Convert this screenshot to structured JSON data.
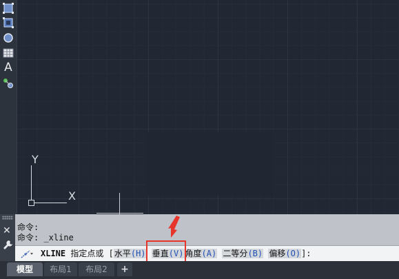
{
  "ucs": {
    "y_label": "Y",
    "x_label": "X"
  },
  "toolbar": {
    "tools": [
      {
        "name": "select-window-icon"
      },
      {
        "name": "crossing-window-icon"
      },
      {
        "name": "polygon-select-icon"
      },
      {
        "name": "table-icon"
      },
      {
        "name": "text-icon",
        "glyph": "A"
      },
      {
        "name": "point-style-icon"
      }
    ]
  },
  "command": {
    "history": [
      "命令:",
      "命令: _xline"
    ],
    "prompt_name": "XLINE",
    "prompt_text": "指定点或",
    "bracket_open": "[",
    "bracket_close": "]:",
    "options": [
      {
        "label": "水平",
        "key": "(H)"
      },
      {
        "label": "垂直",
        "key": "(V)"
      },
      {
        "label": "角度",
        "key": "(A)"
      },
      {
        "label": "二等分",
        "key": "(B)"
      },
      {
        "label": "偏移",
        "key": "(O)"
      }
    ],
    "close_glyph": "✕",
    "wrench_glyph": "🔧"
  },
  "tabs": {
    "items": [
      "模型",
      "布局1",
      "布局2"
    ],
    "active_index": 0,
    "add_label": "+"
  },
  "colors": {
    "highlight": "#e8352c",
    "option_key": "#1f4fb5",
    "canvas_bg": "#222833"
  }
}
